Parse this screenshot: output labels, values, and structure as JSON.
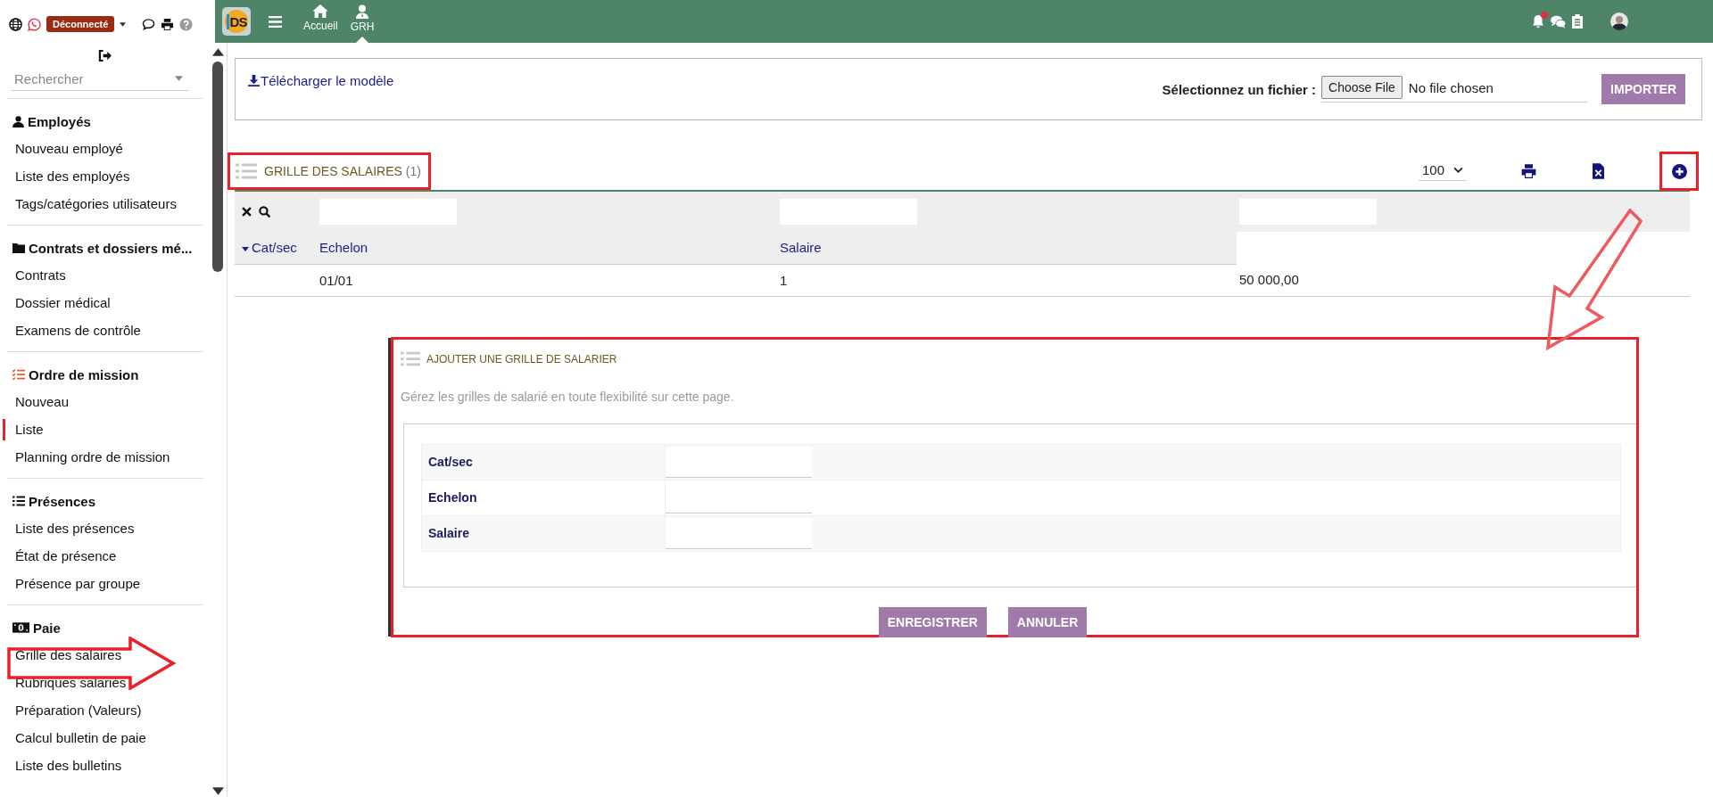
{
  "sidebar": {
    "status_badge": "Déconnecté",
    "search": {
      "placeholder": "Rechercher"
    },
    "sections": [
      {
        "title": "Employés",
        "items": [
          {
            "label": "Nouveau employé",
            "selected": false
          },
          {
            "label": "Liste des employés",
            "selected": false
          },
          {
            "label": "Tags/catégories utilisateurs",
            "selected": false
          }
        ]
      },
      {
        "title": "Contrats et dossiers mé...",
        "items": [
          {
            "label": "Contrats",
            "selected": false
          },
          {
            "label": "Dossier médical",
            "selected": false
          },
          {
            "label": "Examens de contrôle",
            "selected": false
          }
        ]
      },
      {
        "title": "Ordre de mission",
        "items": [
          {
            "label": "Nouveau",
            "selected": false
          },
          {
            "label": "Liste",
            "selected": true
          },
          {
            "label": "Planning ordre de mission",
            "selected": false
          }
        ]
      },
      {
        "title": "Présences",
        "items": [
          {
            "label": "Liste des présences",
            "selected": false
          },
          {
            "label": "État de présence",
            "selected": false
          },
          {
            "label": "Présence par groupe",
            "selected": false
          }
        ]
      },
      {
        "title": "Paie",
        "items": [
          {
            "label": "Grille des salaires",
            "selected": false
          },
          {
            "label": "Rubriques salariés",
            "selected": false
          },
          {
            "label": "Préparation (Valeurs)",
            "selected": false
          },
          {
            "label": "Calcul bulletin de paie",
            "selected": false
          },
          {
            "label": "Liste des bulletins",
            "selected": false
          }
        ]
      }
    ]
  },
  "topbar": {
    "logo": "DS",
    "nav": [
      {
        "label": "Accueil",
        "selected": false
      },
      {
        "label": "GRH",
        "selected": true
      }
    ],
    "notifications": {
      "unread": true
    }
  },
  "upload": {
    "download_link": "Télécharger le modèle",
    "file_label": "Sélectionnez un fichier :",
    "file_button": "Choose File",
    "file_status": "No file chosen",
    "import_button": "IMPORTER"
  },
  "grid": {
    "title": "GRILLE DES SALAIRES",
    "count": "(1)",
    "page_size": "100",
    "columns": [
      {
        "label": "Cat/sec",
        "sorted": true
      },
      {
        "label": "Echelon",
        "sorted": false
      },
      {
        "label": "Salaire",
        "sorted": false
      }
    ],
    "rows": [
      {
        "cells": [
          "",
          "01/01",
          "1",
          "50 000,00"
        ]
      }
    ]
  },
  "form": {
    "title": "AJOUTER UNE GRILLE DE SALARIER",
    "description": "Gérez les grilles de salarié en toute flexibilité sur cette page.",
    "fields": [
      {
        "label": "Cat/sec"
      },
      {
        "label": "Echelon"
      },
      {
        "label": "Salaire"
      }
    ],
    "buttons": [
      "ENREGISTRER",
      "ANNULER"
    ]
  }
}
